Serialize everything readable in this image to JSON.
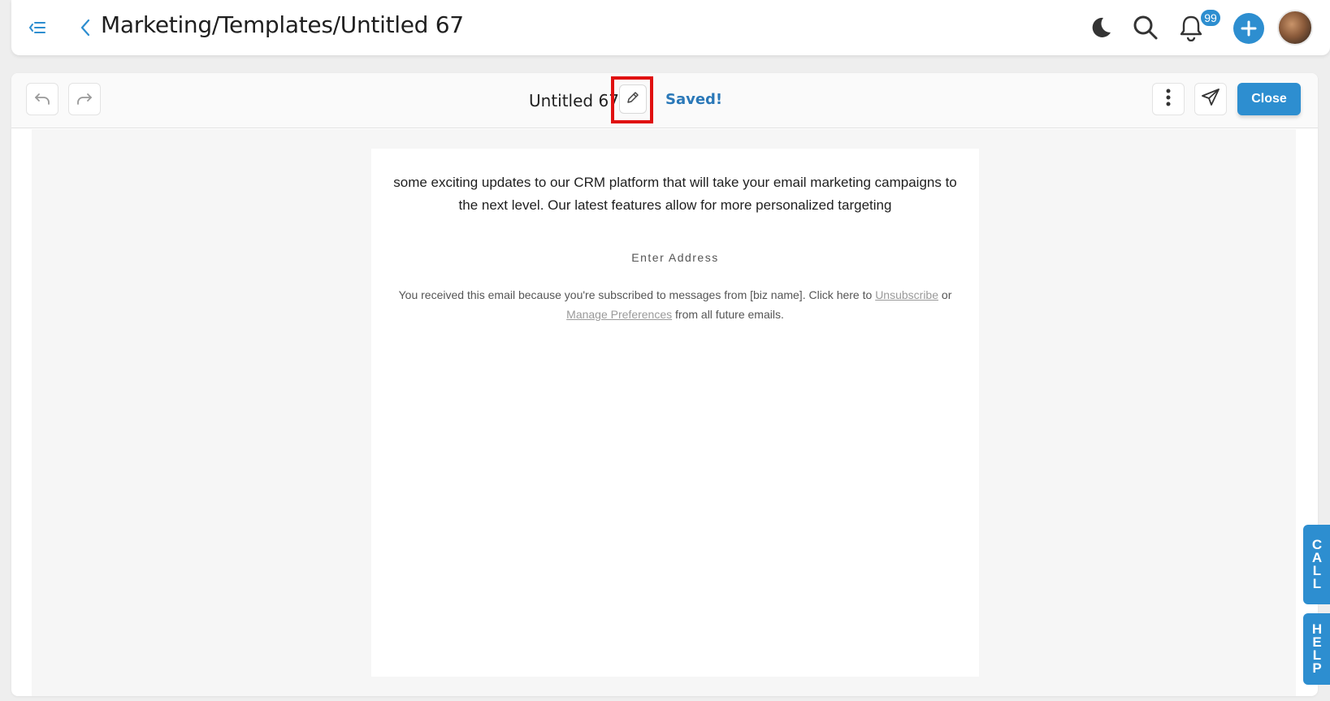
{
  "header": {
    "title": "Marketing/Templates/Untitled 67",
    "notification_count": "99"
  },
  "toolbar": {
    "document_name": "Untitled 67",
    "save_status": "Saved!",
    "close_label": "Close"
  },
  "email": {
    "intro_text": "some exciting updates to our CRM platform that will take your email marketing campaigns to the next level. Our latest features allow for more personalized targeting",
    "address_placeholder": "Enter Address",
    "footer_prefix": "You received this email because you're subscribed to messages from [biz name]. Click here to",
    "unsubscribe_link": "Unsubscribe",
    "footer_or": "or",
    "manage_link": "Manage Preferences",
    "footer_suffix": "from all future emails."
  },
  "side_tabs": {
    "call": [
      "C",
      "A",
      "L",
      "L"
    ],
    "help": [
      "H",
      "E",
      "L",
      "P"
    ]
  },
  "colors": {
    "accent": "#2d8ed0",
    "saved_text": "#2a78b8",
    "highlight_border": "#e01010"
  }
}
